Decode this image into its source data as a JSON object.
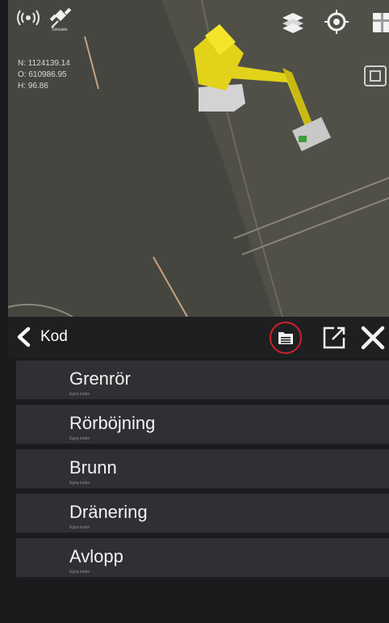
{
  "map": {
    "coords": {
      "n": "N: 1124139.14",
      "o": "O: 610986.95",
      "h": "H: 96.86"
    },
    "gps_label": "Simulate",
    "icons": [
      "signal-icon",
      "gps-satellite-icon",
      "layers-icon",
      "target-icon",
      "box-icon",
      "fit-view-icon"
    ]
  },
  "panel": {
    "back_icon": "chevron-left-icon",
    "title": "Kod",
    "actions": [
      "document-list-icon",
      "open-external-icon",
      "close-icon"
    ],
    "items": [
      {
        "label": "Grenrör",
        "sub": "Egna koder"
      },
      {
        "label": "Rörböjning",
        "sub": "Egna koder"
      },
      {
        "label": "Brunn",
        "sub": "Egna koder"
      },
      {
        "label": "Dränering",
        "sub": "Egna koder"
      },
      {
        "label": "Avlopp",
        "sub": "Egna koder"
      }
    ]
  },
  "colors": {
    "accent_highlight": "#d0202b",
    "excavator": "#e2d21a",
    "background": "#1a1b1d",
    "list_item": "#2f3033"
  }
}
